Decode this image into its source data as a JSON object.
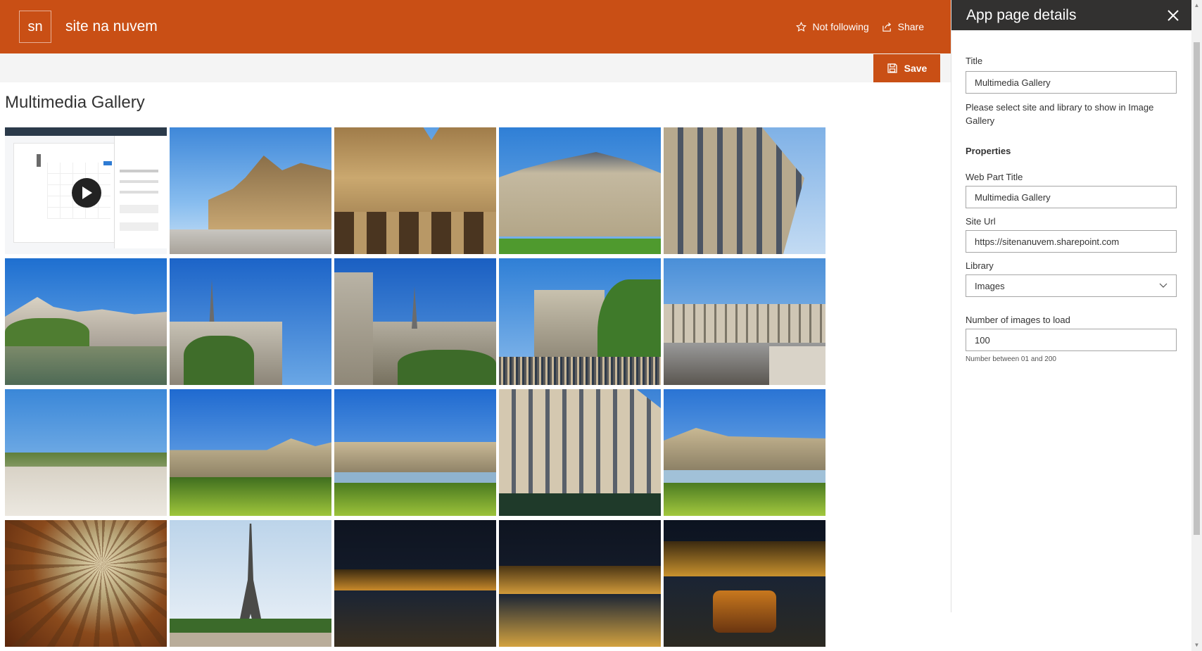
{
  "header": {
    "logo_initials": "sn",
    "site_title": "site na nuvem",
    "follow_label": "Not following",
    "share_label": "Share",
    "brand_color": "#c94f15"
  },
  "commandbar": {
    "save_label": "Save"
  },
  "main": {
    "page_title": "Multimedia Gallery",
    "gallery": [
      {
        "kind": "video",
        "subject": "video thumbnail - calendar app"
      },
      {
        "kind": "image",
        "subject": "Louvre courtyard"
      },
      {
        "kind": "image",
        "subject": "Louvre facade arches"
      },
      {
        "kind": "image",
        "subject": "Parisian building with lawn"
      },
      {
        "kind": "image",
        "subject": "Haussmann building corner"
      },
      {
        "kind": "image",
        "subject": "Hotel de Ville riverside"
      },
      {
        "kind": "image",
        "subject": "Notre-Dame spire"
      },
      {
        "kind": "image",
        "subject": "Notre-Dame towers"
      },
      {
        "kind": "image",
        "subject": "Notre-Dame front crowd"
      },
      {
        "kind": "image",
        "subject": "Paris street bridge"
      },
      {
        "kind": "image",
        "subject": "Tuileries crowd"
      },
      {
        "kind": "image",
        "subject": "Louvre lawn"
      },
      {
        "kind": "image",
        "subject": "Louvre pool"
      },
      {
        "kind": "image",
        "subject": "Grand hotel facade"
      },
      {
        "kind": "image",
        "subject": "Louvre lawn pool"
      },
      {
        "kind": "image",
        "subject": "Galeries Lafayette dome"
      },
      {
        "kind": "image",
        "subject": "Eiffel Tower"
      },
      {
        "kind": "image",
        "subject": "Porto night bridge"
      },
      {
        "kind": "image",
        "subject": "Porto night riverside"
      },
      {
        "kind": "image",
        "subject": "Porto night boat"
      }
    ]
  },
  "panel": {
    "title": "App page details",
    "title_label": "Title",
    "title_value": "Multimedia Gallery",
    "instructions": "Please select site and library to show in Image Gallery",
    "properties_heading": "Properties",
    "webpart_title_label": "Web Part Title",
    "webpart_title_value": "Multimedia Gallery",
    "site_url_label": "Site Url",
    "site_url_value": "https://sitenanuvem.sharepoint.com",
    "library_label": "Library",
    "library_value": "Images",
    "count_label": "Number of images to load",
    "count_value": "100",
    "count_hint": "Number between 01 and 200"
  }
}
